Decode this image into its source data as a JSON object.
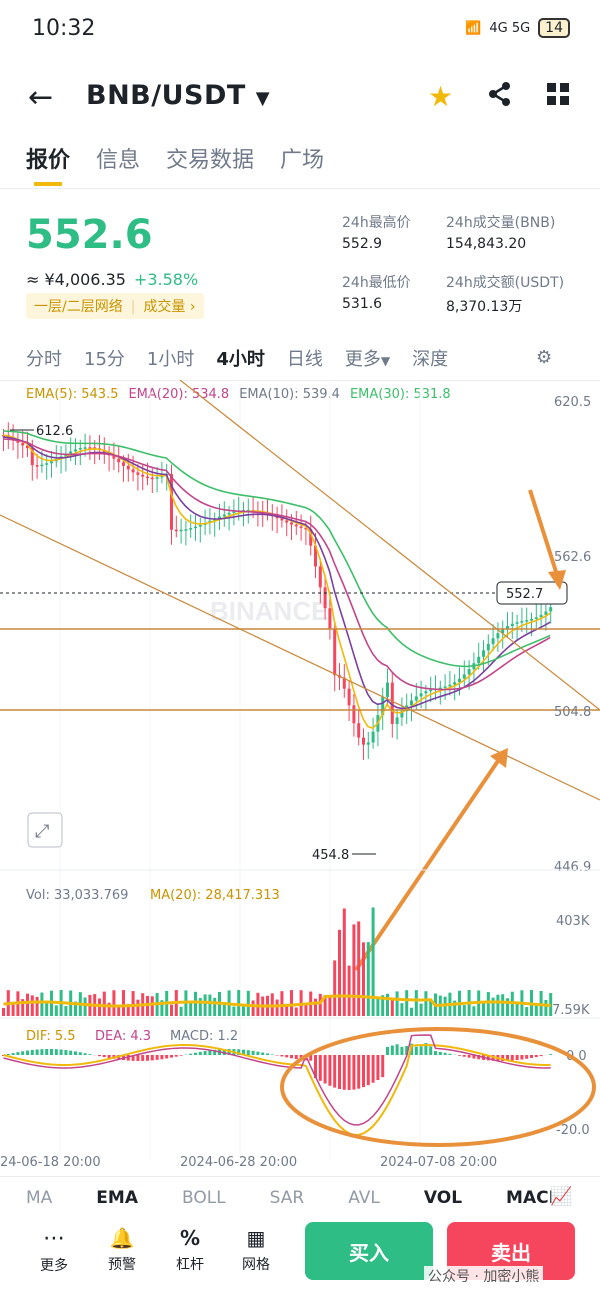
{
  "status": {
    "time": "10:32",
    "signal": "4G  5G",
    "battery": "14"
  },
  "header": {
    "pair": "BNB/USDT"
  },
  "tabs": [
    "报价",
    "信息",
    "交易数据",
    "广场"
  ],
  "ticker": {
    "price": "552.6",
    "cny": "≈ ¥4,006.35",
    "change": "+3.58%",
    "layer_tag": "一层/二层网络",
    "volume_tag": "成交量",
    "high_label": "24h最高价",
    "high": "552.9",
    "low_label": "24h最低价",
    "low": "531.6",
    "vol_bnb_label": "24h成交量(BNB)",
    "vol_bnb": "154,843.20",
    "vol_usdt_label": "24h成交额(USDT)",
    "vol_usdt": "8,370.13万"
  },
  "intervals": [
    "分时",
    "15分",
    "1小时",
    "4小时",
    "日线",
    "更多",
    "深度"
  ],
  "ema": {
    "ema5": "EMA(5): 543.5",
    "ema20": "EMA(20): 534.8",
    "ema10": "EMA(10): 539.4",
    "ema30": "EMA(30): 531.8"
  },
  "colors": {
    "up": "#2ebd85",
    "down": "#f6465d",
    "ema5": "#f0b90b",
    "ema20": "#c3448b",
    "ema10": "#7b3fa0",
    "ema30": "#3dbf6a",
    "annotation": "#e8913a"
  },
  "price_axis": [
    "620.5",
    "562.6",
    "504.8",
    "446.9"
  ],
  "price_labels": {
    "high": "612.6",
    "low": "454.8",
    "current": "552.7"
  },
  "watermark": "BINANCE",
  "volume": {
    "vol": "Vol: 33,033.769",
    "ma20": "MA(20): 28,417.313",
    "axis_top": "403K",
    "axis_bottom": "7.59K"
  },
  "macd": {
    "dif": "DIF: 5.5",
    "dea": "DEA: 4.3",
    "macd": "MACD: 1.2",
    "axis_top": "0.0",
    "axis_bottom": "-20.0"
  },
  "dates": [
    "24-06-18 20:00",
    "2024-06-28 20:00",
    "2024-07-08 20:00"
  ],
  "indicators": [
    "MA",
    "EMA",
    "BOLL",
    "SAR",
    "AVL",
    "VOL",
    "MACD"
  ],
  "bottom_nav": [
    "更多",
    "预警",
    "杠杆",
    "网格"
  ],
  "actions": {
    "buy": "买入",
    "sell": "卖出"
  },
  "footer_watermark": "公众号 · 加密小熊"
}
